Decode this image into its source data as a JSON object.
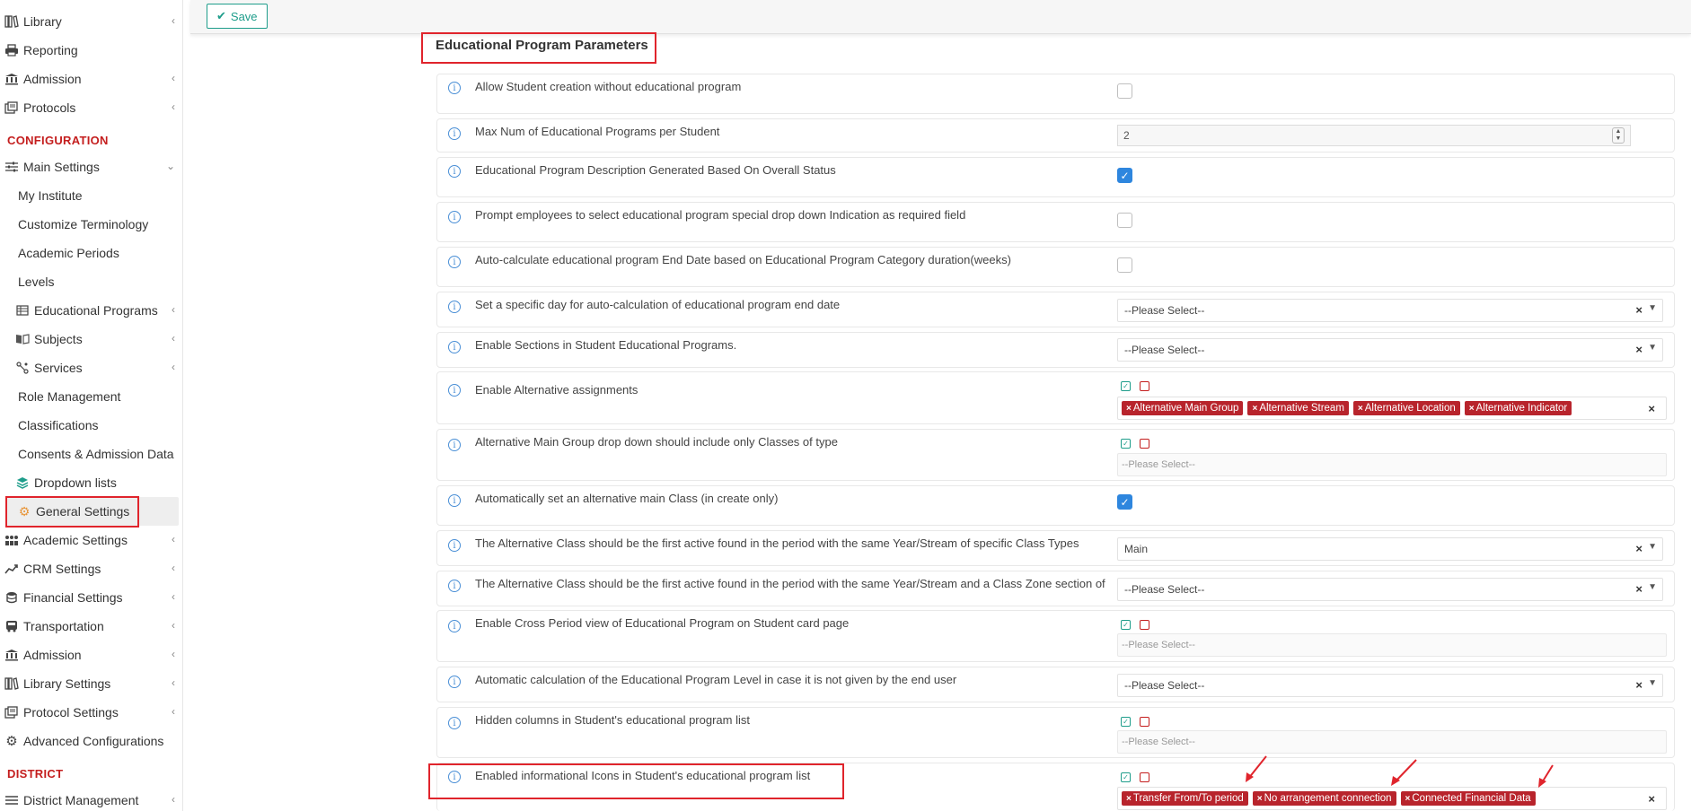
{
  "sidebar": {
    "items_top": [
      {
        "label": "Library",
        "icon": "books-icon",
        "chevron": true
      },
      {
        "label": "Reporting",
        "icon": "printer-icon",
        "chevron": false
      },
      {
        "label": "Admission",
        "icon": "institution-icon",
        "chevron": true
      },
      {
        "label": "Protocols",
        "icon": "file-stack-icon",
        "chevron": true
      }
    ],
    "configuration_title": "CONFIGURATION",
    "main_settings": {
      "label": "Main Settings",
      "icon": "sliders-icon"
    },
    "main_settings_children": [
      "My Institute",
      "Customize Terminology",
      "Academic Periods",
      "Levels"
    ],
    "educational_programs": "Educational Programs",
    "subjects": "Subjects",
    "services": "Services",
    "main_settings_children_2": [
      "Role Management",
      "Classifications",
      "Consents & Admission Data"
    ],
    "dropdown_lists": "Dropdown lists",
    "general_settings": "General Settings",
    "items_after": [
      {
        "label": "Academic Settings",
        "icon": "users-icon"
      },
      {
        "label": "CRM Settings",
        "icon": "chart-icon"
      },
      {
        "label": "Financial Settings",
        "icon": "database-icon"
      },
      {
        "label": "Transportation",
        "icon": "bus-icon"
      },
      {
        "label": "Admission",
        "icon": "institution-icon"
      },
      {
        "label": "Library Settings",
        "icon": "books-icon"
      },
      {
        "label": "Protocol Settings",
        "icon": "file-stack-icon"
      },
      {
        "label": "Advanced Configurations",
        "icon": "gears-icon"
      }
    ],
    "district_title": "DISTRICT",
    "district_management": "District Management"
  },
  "toolbar": {
    "save_label": "Save"
  },
  "panel_title": "Educational Program Parameters",
  "rows": {
    "r1": {
      "label": "Allow Student creation without educational program",
      "checked": false
    },
    "r2": {
      "label": "Max Num of Educational Programs per Student",
      "value": "2"
    },
    "r3": {
      "label": "Educational Program Description Generated Based On Overall Status",
      "checked": true
    },
    "r4": {
      "label": "Prompt employees to select educational program special drop down Indication as required field",
      "checked": false
    },
    "r5": {
      "label": "Auto-calculate educational program End Date based on Educational Program Category duration(weeks)",
      "checked": false
    },
    "r6": {
      "label": "Set a specific day for auto-calculation of educational program end date",
      "select": "--Please Select--"
    },
    "r7": {
      "label": "Enable Sections in Student Educational Programs.",
      "select": "--Please Select--"
    },
    "r8": {
      "label": "Enable Alternative assignments",
      "tags": [
        "Alternative Main Group",
        "Alternative Stream",
        "Alternative Location",
        "Alternative Indicator"
      ]
    },
    "r9": {
      "label": "Alternative Main Group drop down should include only Classes of type",
      "placeholder": "--Please Select--"
    },
    "r10": {
      "label": "Automatically set an alternative main Class (in create only)",
      "checked": true
    },
    "r11": {
      "label": "The Alternative Class should be the first active found in the period with the same Year/Stream of specific Class Types",
      "select": "Main"
    },
    "r12": {
      "label": "The Alternative Class should be the first active found in the period with the same Year/Stream and a Class Zone section of",
      "select": "--Please Select--"
    },
    "r13": {
      "label": "Enable Cross Period view of Educational Program on Student card page",
      "placeholder": "--Please Select--"
    },
    "r14": {
      "label": "Automatic calculation of the Educational Program Level in case it is not given by the end user",
      "select": "--Please Select--"
    },
    "r15": {
      "label": "Hidden columns in Student's educational program list",
      "placeholder": "--Please Select--"
    },
    "r16": {
      "label": "Enabled informational Icons in Student's educational program list",
      "tags": [
        "Transfer From/To period",
        "No arrangement connection",
        "Connected Financial Data"
      ]
    }
  },
  "colors": {
    "accent": "#1e9d8b",
    "tag": "#b8242c",
    "highlight": "#e0242c",
    "section": "#c41e1e",
    "checkbox": "#2e86de"
  }
}
